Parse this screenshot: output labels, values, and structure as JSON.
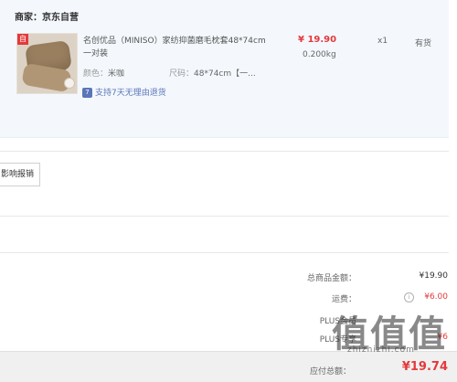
{
  "shop": {
    "label": "商家：京东自营"
  },
  "product": {
    "badge": "自",
    "name": "名创优品（MINISO）家纺抑菌磨毛枕套48*74cm 一对装",
    "price": "¥ 19.90",
    "weight": "0.200kg",
    "qty": "x1",
    "stock": "有货",
    "color_label": "颜色：",
    "color_value": "米咖",
    "size_label": "尺码：",
    "size_value": "48*74cm【一...",
    "return_icon": "7",
    "return_text": "支持7天无理由退货"
  },
  "invoice": {
    "button_label": "影响报销"
  },
  "summary": {
    "total_label": "总商品金额：",
    "total_value": "¥19.90",
    "freight_label": "运费：",
    "freight_value": "¥6.00",
    "plus_label_1": "PLUS会员",
    "plus_label_2": "PLUS专享",
    "plus_value_2": "¥6",
    "pay_label": "应付总额：",
    "pay_value": "¥19.74"
  },
  "watermark": {
    "text": "值值值",
    "sub": "zhizhizhi.com"
  },
  "colors": {
    "accent_red": "#e4393c",
    "card_bg": "#f4f8fd",
    "link_blue": "#5a76b8"
  },
  "icons": {
    "info": "info-circle-icon",
    "return": "return-badge-icon"
  }
}
